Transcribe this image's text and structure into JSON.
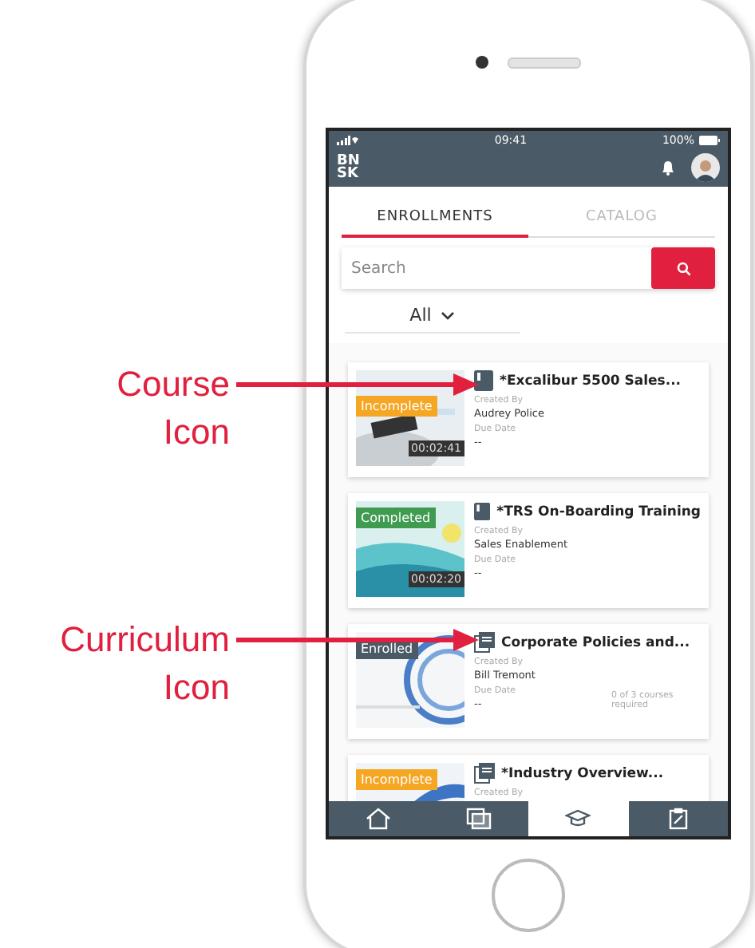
{
  "annotations": [
    {
      "lines": [
        "Course",
        "Icon"
      ]
    },
    {
      "lines": [
        "Curriculum",
        "Icon"
      ]
    }
  ],
  "status_bar": {
    "time": "09:41",
    "battery": "100%"
  },
  "header": {
    "logo": [
      "BN",
      "SK"
    ]
  },
  "tabs": [
    {
      "label": "ENROLLMENTS",
      "selected": true
    },
    {
      "label": "CATALOG",
      "selected": false
    }
  ],
  "search": {
    "placeholder": "Search"
  },
  "filter": {
    "value": "All"
  },
  "cards": [
    {
      "kind": "course",
      "status": "Incomplete",
      "color": "#f5a623",
      "duration": "00:02:41",
      "title": "*Excalibur 5500 Sales...",
      "created_label": "Created By",
      "author": "Audrey Police",
      "due_label": "Due Date",
      "due": "--"
    },
    {
      "kind": "course",
      "status": "Completed",
      "color": "#3e9b4f",
      "duration": "00:02:20",
      "title": "*TRS On-Boarding Training",
      "created_label": "Created By",
      "author": "Sales Enablement",
      "due_label": "Due Date",
      "due": "--"
    },
    {
      "kind": "curriculum",
      "status": "Enrolled",
      "color": "#4a5a66",
      "title": "Corporate Policies and...",
      "created_label": "Created By",
      "author": "Bill Tremont",
      "due_label": "Due Date",
      "due": "--",
      "progress": "0 of 3 courses required"
    },
    {
      "kind": "curriculum",
      "status": "Incomplete",
      "color": "#f5a623",
      "title": "*Industry Overview...",
      "created_label": "Created By"
    }
  ],
  "nav": [
    {
      "selected": false
    },
    {
      "selected": false
    },
    {
      "selected": true
    },
    {
      "selected": false
    }
  ]
}
